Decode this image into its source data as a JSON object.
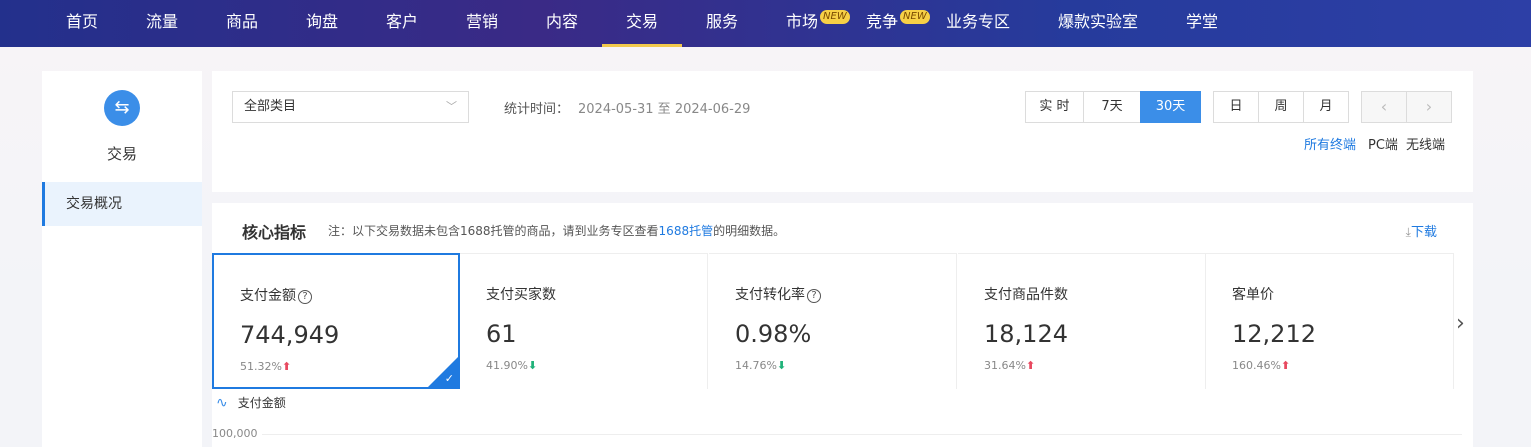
{
  "nav": {
    "items": [
      {
        "label": "首页"
      },
      {
        "label": "流量"
      },
      {
        "label": "商品"
      },
      {
        "label": "询盘"
      },
      {
        "label": "客户"
      },
      {
        "label": "营销"
      },
      {
        "label": "内容"
      },
      {
        "label": "交易",
        "active": true
      },
      {
        "label": "服务"
      },
      {
        "label": "市场",
        "badge": "NEW"
      },
      {
        "label": "竞争",
        "badge": "NEW"
      },
      {
        "label": "业务专区"
      },
      {
        "label": "爆款实验室"
      },
      {
        "label": "学堂"
      }
    ],
    "accent": "#f2c94c"
  },
  "sidebar": {
    "icon": "exchange-icon",
    "title": "交易",
    "items": [
      {
        "label": "交易概况",
        "active": true
      }
    ]
  },
  "filter": {
    "category": "全部类目",
    "stat_label": "统计时间：",
    "stat_range": "2024-05-31 至 2024-06-29",
    "period_buttons": [
      {
        "label": "实 时"
      },
      {
        "label": "7天"
      },
      {
        "label": "30天",
        "active": true
      }
    ],
    "granularity_buttons": [
      {
        "label": "日"
      },
      {
        "label": "周"
      },
      {
        "label": "月"
      }
    ],
    "prev": "‹",
    "next": "›",
    "terminals": [
      {
        "label": "所有终端",
        "active": true
      },
      {
        "label": "PC端"
      },
      {
        "label": "无线端"
      }
    ]
  },
  "metrics": {
    "title": "核心指标",
    "note_prefix": "注：以下交易数据未包含1688托管的商品，请到业务专区查看",
    "note_link": "1688托管",
    "note_suffix": "的明细数据。",
    "download": "下载",
    "cards": [
      {
        "label": "支付金额",
        "help": true,
        "value": "744,949",
        "change": "51.32%",
        "trend": "up",
        "selected": true
      },
      {
        "label": "支付买家数",
        "value": "61",
        "change": "41.90%",
        "trend": "down"
      },
      {
        "label": "支付转化率",
        "help": true,
        "value": "0.98%",
        "change": "14.76%",
        "trend": "down"
      },
      {
        "label": "支付商品件数",
        "value": "18,124",
        "change": "31.64%",
        "trend": "up"
      },
      {
        "label": "客单价",
        "value": "12,212",
        "change": "160.46%",
        "trend": "up"
      }
    ],
    "chart_legend": "支付金额",
    "y_tick": "100,000"
  },
  "colors": {
    "primary": "#1f7ae0",
    "up": "#e8495f",
    "down": "#20b27a"
  }
}
